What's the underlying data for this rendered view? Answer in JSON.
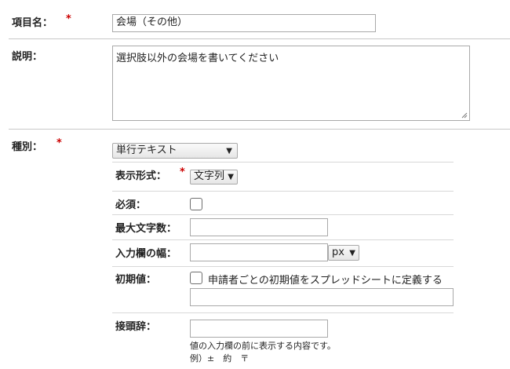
{
  "item_name": {
    "label": "項目名：",
    "required_mark": "*",
    "value": "会場（その他）"
  },
  "description": {
    "label": "説明：",
    "value": "選択肢以外の会場を書いてください"
  },
  "type": {
    "label": "種別：",
    "required_mark": "*",
    "selected": "単行テキスト",
    "display_format": {
      "label": "表示形式：",
      "required_mark": "*",
      "selected": "文字列"
    },
    "required_field": {
      "label": "必須：",
      "checked": false
    },
    "max_chars": {
      "label": "最大文字数：",
      "value": ""
    },
    "input_width": {
      "label": "入力欄の幅：",
      "value": "",
      "unit": "px"
    },
    "initial_value": {
      "label": "初期値：",
      "spreadsheet_option": "申請者ごとの初期値をスプレッドシートに定義する",
      "checked": false,
      "value": ""
    },
    "prefix": {
      "label": "接頭辞：",
      "value": "",
      "help_line1": "値の入力欄の前に表示する内容です。",
      "help_line2": "例）±　約　〒"
    }
  },
  "icons": {
    "dropdown": "caret-down-icon",
    "resize": "resize-grip-icon"
  }
}
